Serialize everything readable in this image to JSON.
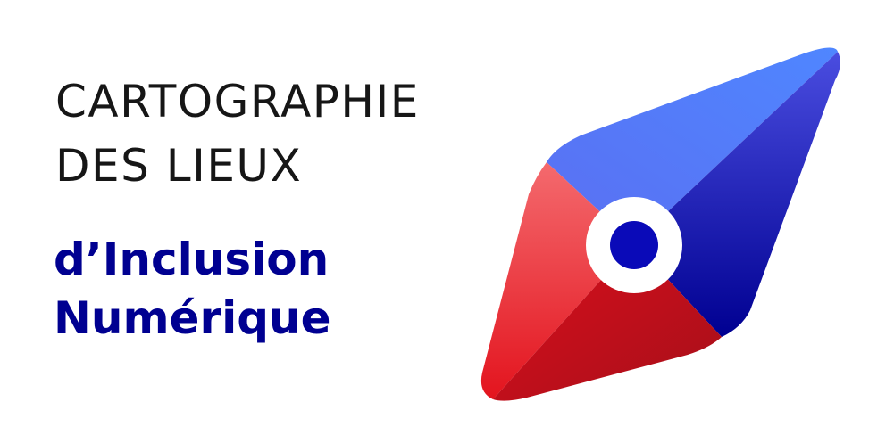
{
  "title": {
    "line1": "CARTOGRAPHIE",
    "line2": "DES LIEUX"
  },
  "subtitle": {
    "line1": "d’Inclusion",
    "line2": "Numérique"
  },
  "logo": {
    "icon": "compass-icon",
    "colors": {
      "blue_light": "#5b7cf5",
      "blue_dark": "#000091",
      "red_light": "#f25a5f",
      "red_dark": "#c8101c",
      "center": "#0a0ab8"
    }
  }
}
